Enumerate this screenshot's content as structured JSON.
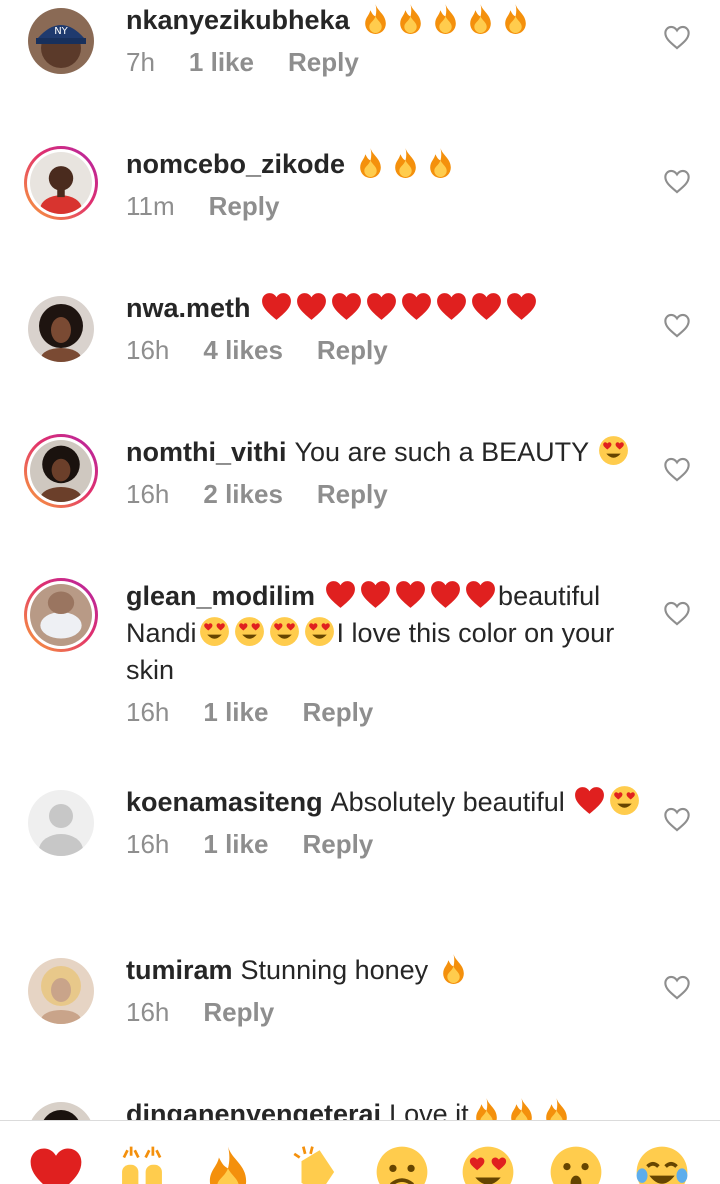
{
  "comments": [
    {
      "username": "nkanyezikubheka",
      "text": "",
      "emojis": [
        "fire",
        "fire",
        "fire",
        "fire",
        "fire"
      ],
      "time": "7h",
      "likes": "1 like",
      "reply": "Reply",
      "avatar": "cap-man",
      "ring": false
    },
    {
      "username": "nomcebo_zikode",
      "text": "",
      "emojis": [
        "fire",
        "fire",
        "fire"
      ],
      "time": "11m",
      "likes": "",
      "reply": "Reply",
      "avatar": "woman-red",
      "ring": true
    },
    {
      "username": "nwa.meth",
      "text": "",
      "emojis": [
        "heart",
        "heart",
        "heart",
        "heart",
        "heart",
        "heart",
        "heart",
        "heart"
      ],
      "time": "16h",
      "likes": "4 likes",
      "reply": "Reply",
      "avatar": "woman-curly",
      "ring": false
    },
    {
      "username": "nomthi_vithi",
      "text": "You are such a BEAUTY",
      "emojis": [
        "heart-eyes"
      ],
      "time": "16h",
      "likes": "2 likes",
      "reply": "Reply",
      "avatar": "woman-dark",
      "ring": true
    },
    {
      "username": "glean_modilim",
      "text": "",
      "time": "16h",
      "likes": "1 like",
      "reply": "Reply",
      "avatar": "woman-white",
      "ring": true,
      "part1": "beautiful Nandi",
      "part2": "I love this color on your skin"
    },
    {
      "username": "koenamasiteng",
      "text": "Absolutely beautiful",
      "emojis": [
        "heart",
        "heart-eyes"
      ],
      "time": "16h",
      "likes": "1 like",
      "reply": "Reply",
      "avatar": "default",
      "ring": false
    },
    {
      "username": "tumiram",
      "text": "Stunning honey",
      "emojis": [
        "fire"
      ],
      "time": "16h",
      "likes": "",
      "reply": "Reply",
      "avatar": "woman-blonde",
      "ring": false
    },
    {
      "username": "dinganenyengeterai",
      "text": "Love it",
      "emojis": [
        "fire",
        "fire",
        "fire"
      ],
      "time": "",
      "likes": "",
      "reply": "",
      "avatar": "woman-dark",
      "ring": false
    }
  ],
  "reactions": [
    "red-heart-icon",
    "raising-hands-icon",
    "fire-icon",
    "clapping-hands-icon",
    "sad-face-icon",
    "heart-eyes-icon",
    "surprised-face-icon",
    "tears-of-joy-icon"
  ],
  "colors": {
    "text": "#262626",
    "muted": "#8e8e8e",
    "heart": "#e0201f",
    "ring_start": "#f9a33a",
    "ring_end": "#b023a9"
  }
}
